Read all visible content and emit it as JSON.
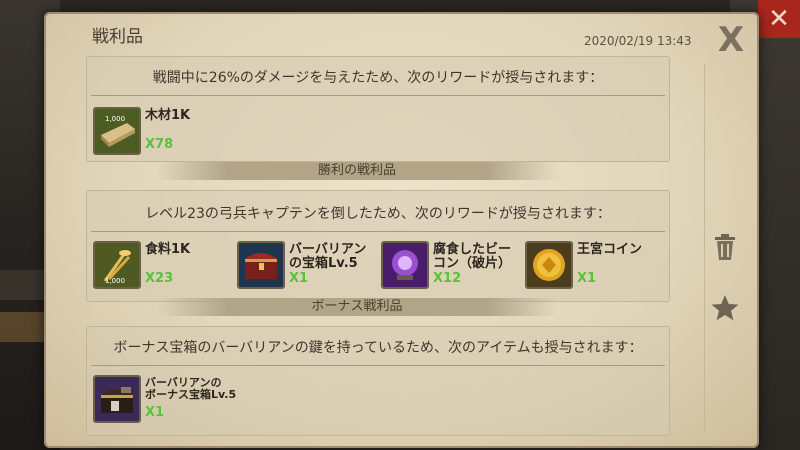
{
  "panel": {
    "title": "戦利品",
    "timestamp": "2020/02/19 13:43",
    "close_glyph": "X"
  },
  "sections": [
    {
      "heading": "戦闘中に26%のダメージを与えたため、次のリワードが授与されます：",
      "items": [
        {
          "name": "木材1K",
          "qty": "X78",
          "icon": "wood-icon"
        }
      ]
    },
    {
      "divider": "勝利の戦利品",
      "heading": "レベル23の弓兵キャプテンを倒したため、次のリワードが授与されます：",
      "items": [
        {
          "name": "食料1K",
          "qty": "X23",
          "icon": "food-icon"
        },
        {
          "name_line1": "バーバリアン",
          "name_line2": "の宝箱Lv.5",
          "qty": "X1",
          "icon": "chest-icon"
        },
        {
          "name_line1": "腐食したビー",
          "name_line2": "コン（破片）",
          "qty": "X12",
          "icon": "beacon-icon"
        },
        {
          "name": "王宮コイン",
          "qty": "X1",
          "icon": "coin-icon"
        }
      ]
    },
    {
      "divider": "ボーナス戦利品",
      "heading": "ボーナス宝箱のバーバリアンの鍵を持っているため、次のアイテムも授与されます：",
      "items": [
        {
          "name_line1": "バーバリアンの",
          "name_line2": "ボーナス宝箱Lv.5",
          "qty": "X1",
          "icon": "bonus-chest-icon"
        }
      ]
    }
  ],
  "icons": {
    "wood_badge": "1,000",
    "food_badge": "1,000"
  },
  "colors": {
    "quantity": "#57c33a",
    "close_bg": "#a8261c",
    "parchment": "#e2d6ba"
  }
}
